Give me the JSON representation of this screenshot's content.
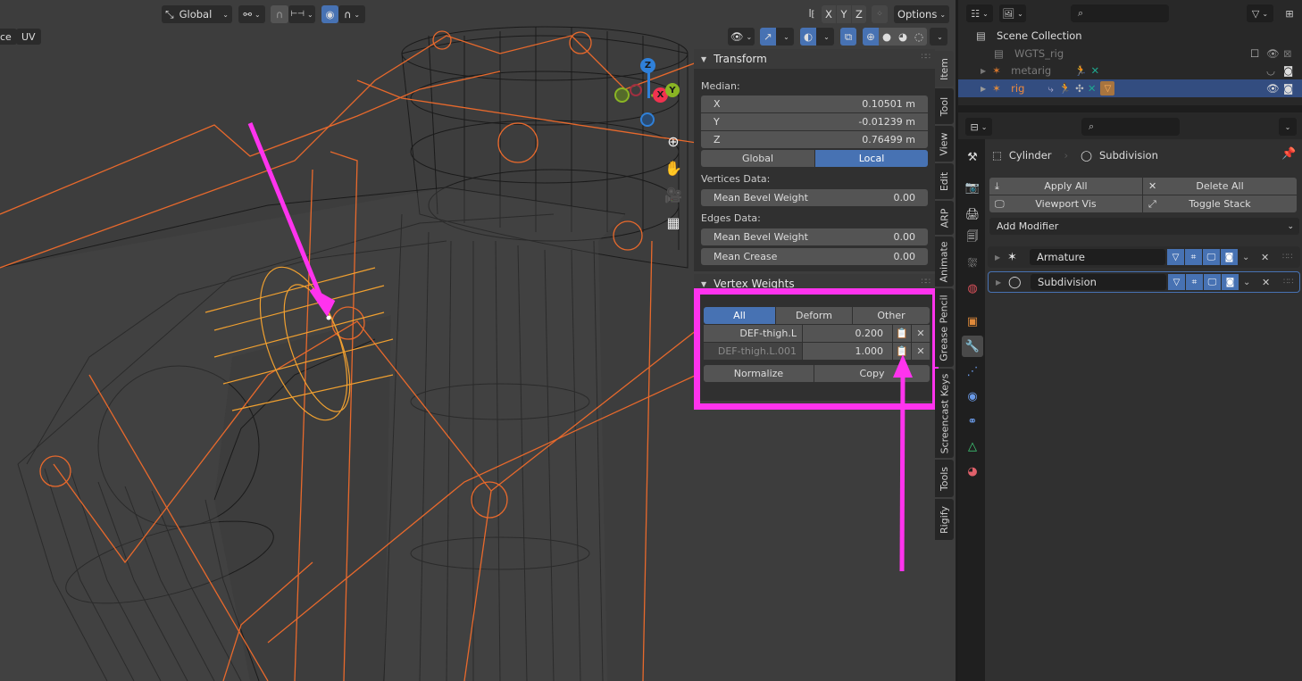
{
  "viewport": {
    "header": {
      "orientation": {
        "icon": "transform-orientation-icon",
        "label": "Global"
      },
      "pivot_icon": "pivot-point-icon",
      "snap_icon": "magnet-snap-icon",
      "snap_target_icon": "snap-increment-icon",
      "proportional_icon": "proportional-editing-icon",
      "falloff_icon": "falloff-curve-icon",
      "mirror_icon": "mirror-icon",
      "mirror_axes": [
        "X",
        "Y",
        "Z"
      ],
      "auto_merge_icon": "auto-merge-icon",
      "options_label": "Options",
      "visibility_icon": "selectability-visibility-icon",
      "gizmo_icon": "gizmo-toggle-icon",
      "overlay_icon": "overlay-toggle-icon",
      "xray_icon": "xray-toggle-icon",
      "shading_modes": [
        "wireframe",
        "solid",
        "material-preview",
        "rendered"
      ],
      "active_shading": "wireframe"
    },
    "mode_tabs": [
      "ce",
      "UV"
    ],
    "gizmo": {
      "axes": [
        "Z",
        "X",
        "Y"
      ]
    },
    "nav_icons": [
      "zoom-icon",
      "pan-hand-icon",
      "camera-view-icon",
      "ortho-grid-icon"
    ]
  },
  "npanel": {
    "transform": {
      "title": "Transform",
      "median_label": "Median:",
      "coords": [
        {
          "axis": "X",
          "value": "0.10501 m"
        },
        {
          "axis": "Y",
          "value": "-0.01239 m"
        },
        {
          "axis": "Z",
          "value": "0.76499 m"
        }
      ],
      "space_options": [
        "Global",
        "Local"
      ],
      "active_space": "Local",
      "vertices_label": "Vertices Data:",
      "vertices_fields": [
        {
          "label": "Mean Bevel Weight",
          "value": "0.00"
        }
      ],
      "edges_label": "Edges Data:",
      "edges_fields": [
        {
          "label": "Mean Bevel Weight",
          "value": "0.00"
        },
        {
          "label": "Mean Crease",
          "value": "0.00"
        }
      ]
    },
    "vertex_weights": {
      "title": "Vertex Weights",
      "filters": [
        "All",
        "Deform",
        "Other"
      ],
      "active_filter": "All",
      "groups": [
        {
          "name": "DEF-thigh.L",
          "weight": "0.200",
          "active": true
        },
        {
          "name": "DEF-thigh.L.001",
          "weight": "1.000",
          "active": false
        }
      ],
      "normalize_label": "Normalize",
      "copy_label": "Copy"
    },
    "tabs": [
      "Item",
      "Tool",
      "View",
      "Edit",
      "ARP",
      "Animate",
      "Grease Pencil",
      "Screencast Keys",
      "Tools",
      "Rigify"
    ],
    "active_tab": "Item"
  },
  "outliner": {
    "search_placeholder": "",
    "items": [
      {
        "name": "Scene Collection",
        "icon": "scene-collection-icon",
        "level": 0
      },
      {
        "name": "WGTS_rig",
        "icon": "collection-icon",
        "level": 1,
        "dim": true
      },
      {
        "name": "metarig",
        "icon": "armature-icon",
        "level": 1,
        "dim": true
      },
      {
        "name": "rig",
        "icon": "armature-icon",
        "level": 1,
        "selected": true
      }
    ]
  },
  "properties": {
    "search_placeholder": "",
    "breadcrumb": {
      "object": "Cylinder",
      "modifier": "Subdivision"
    },
    "buttons": {
      "apply_all": "Apply All",
      "delete_all": "Delete All",
      "viewport_vis": "Viewport Vis",
      "toggle_stack": "Toggle Stack"
    },
    "add_modifier_label": "Add Modifier",
    "modifiers": [
      {
        "name": "Armature",
        "icon": "armature-modifier-icon"
      },
      {
        "name": "Subdivision",
        "icon": "subdivision-modifier-icon",
        "selected": true
      }
    ],
    "tabs": [
      "tool",
      "render",
      "output",
      "view-layer",
      "scene",
      "world",
      "object",
      "modifiers",
      "particles",
      "physics",
      "constraints",
      "data",
      "material"
    ],
    "active_tab": "modifiers"
  },
  "colors": {
    "accent": "#4772b3",
    "annotation": "#ff33ee",
    "bone_orange": "#e8692c",
    "selected_orange": "#f5a623"
  }
}
